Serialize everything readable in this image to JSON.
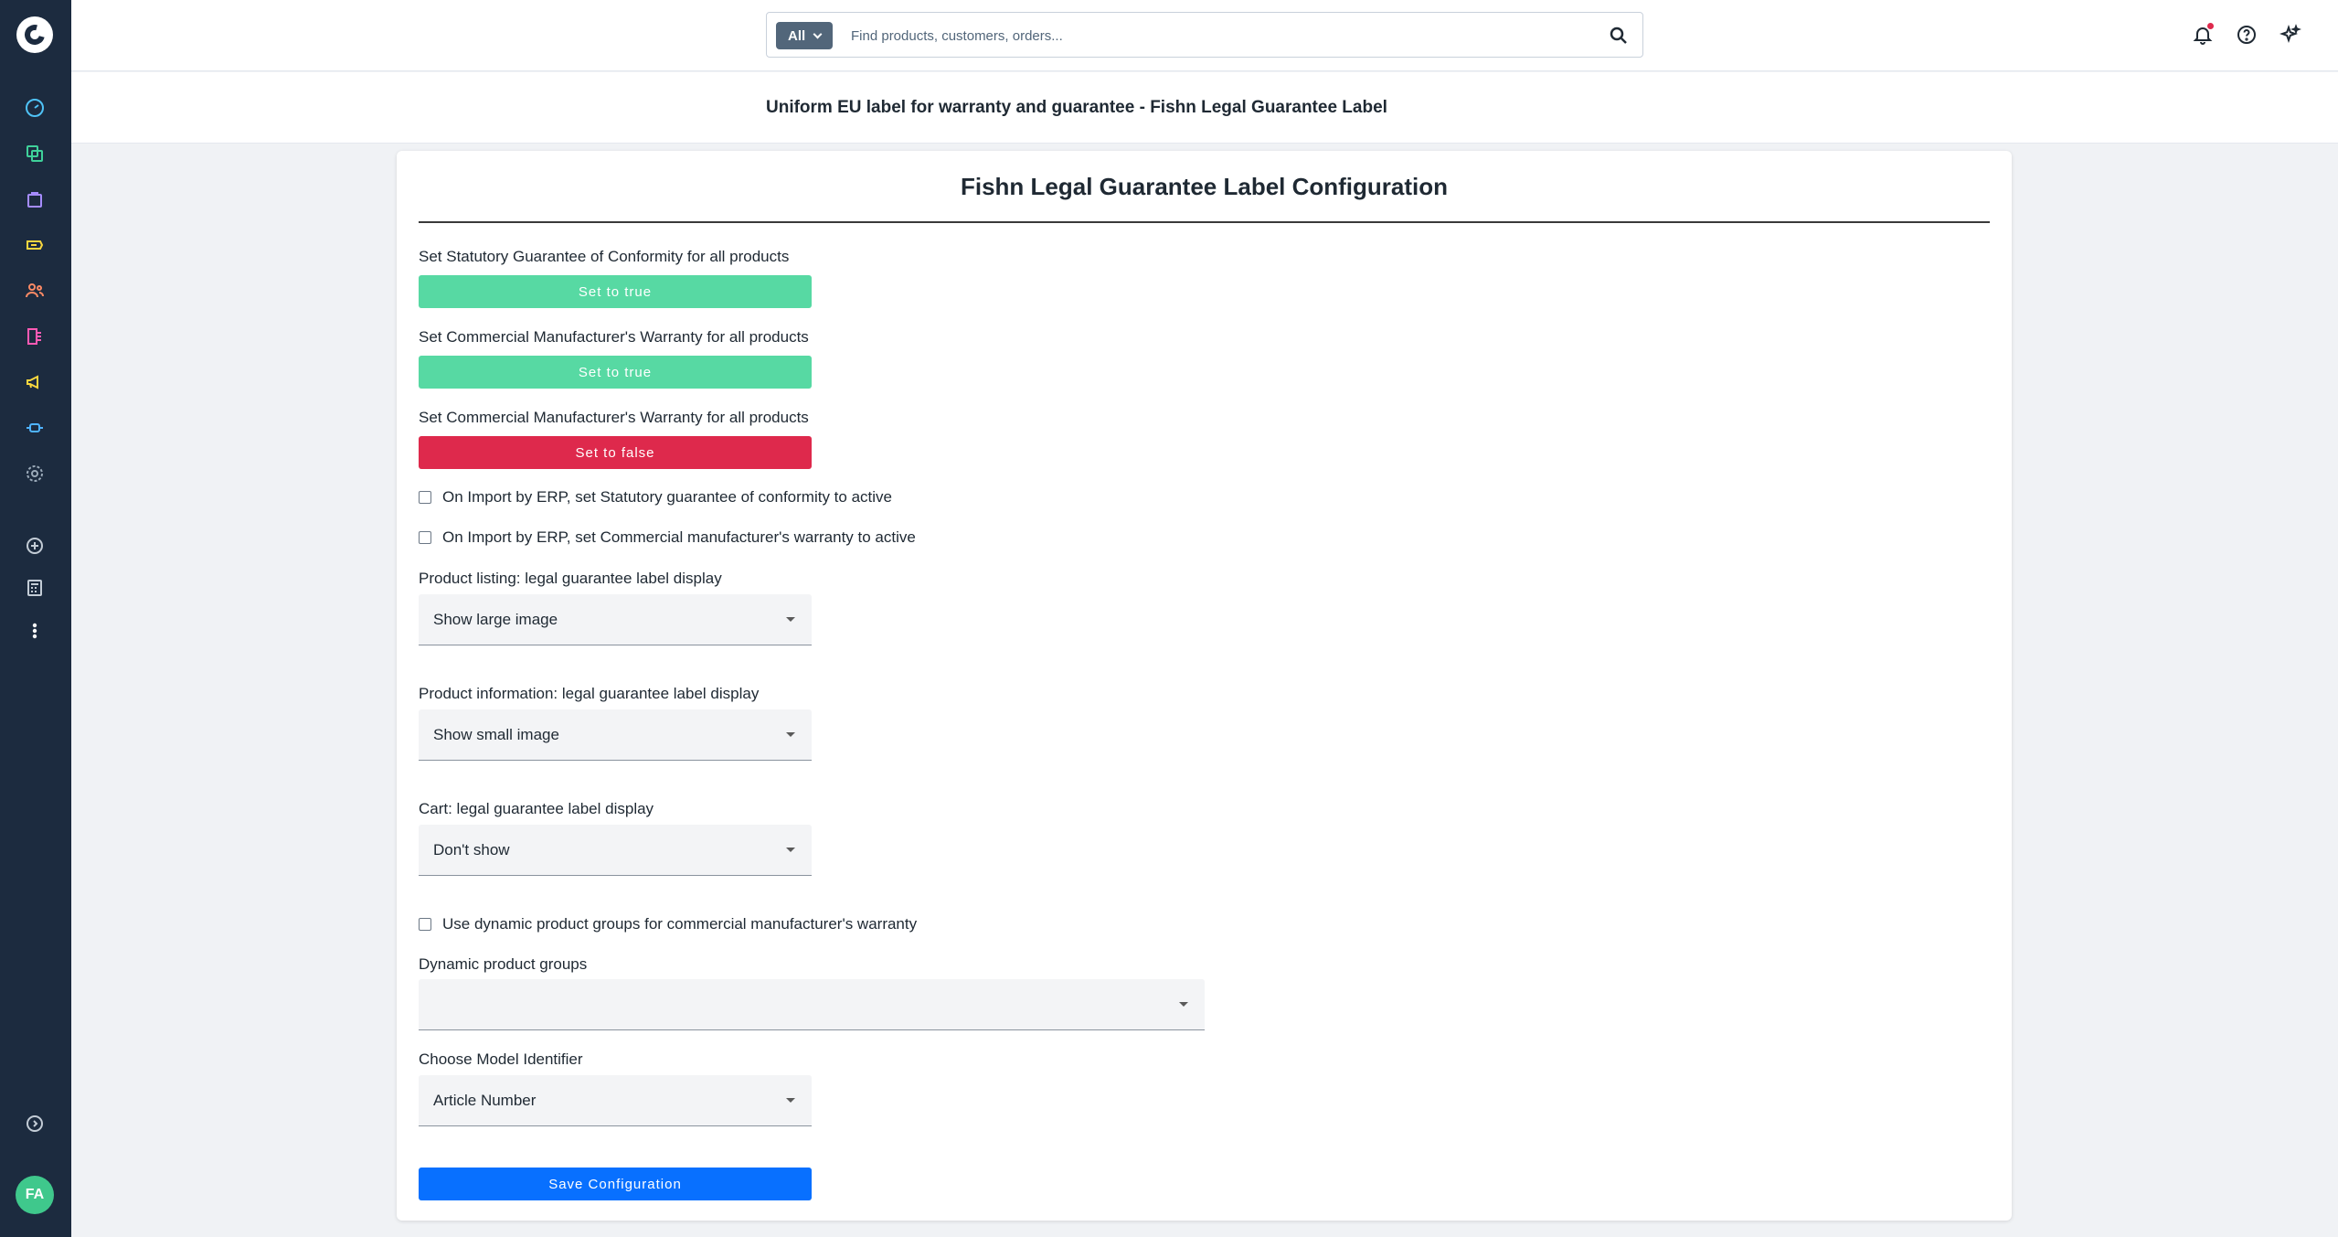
{
  "app": {
    "page_title": "Uniform EU label for warranty and guarantee - Fishn Legal Guarantee Label",
    "user_initials": "FA"
  },
  "colors": {
    "sidebar_bg": "#1c2b3f",
    "true_button": "#57d9a3",
    "false_button": "#de294c",
    "primary_button": "#0870ff",
    "avatar": "#3fc88c"
  },
  "sidebar": {
    "items": [
      {
        "icon": "gauge-icon",
        "color": "#4fc3f7"
      },
      {
        "icon": "catalog-icon",
        "color": "#3fd19a"
      },
      {
        "icon": "orders-bag-icon",
        "color": "#a58cff"
      },
      {
        "icon": "customers-ticket-icon",
        "color": "#f7d63f"
      },
      {
        "icon": "users-icon",
        "color": "#ff8a65"
      },
      {
        "icon": "content-icon",
        "color": "#ff5ab4"
      },
      {
        "icon": "marketing-megaphone-icon",
        "color": "#f7d63f"
      },
      {
        "icon": "extensions-plug-icon",
        "color": "#4fb3ff"
      },
      {
        "icon": "settings-gear-icon",
        "color": "#9aa9b8"
      },
      {
        "icon": "add-circle-icon",
        "color": "#c3ccd6"
      },
      {
        "icon": "calculator-icon",
        "color": "#c3ccd6"
      },
      {
        "icon": "more-vertical-icon",
        "color": "#ffffff"
      },
      {
        "icon": "expand-chevron-icon",
        "color": "#c3ccd6"
      }
    ]
  },
  "search": {
    "scope_label": "All",
    "placeholder": "Find products, customers, orders..."
  },
  "config": {
    "title": "Fishn Legal Guarantee Label Configuration",
    "statutory_label": "Set Statutory Guarantee of Conformity for all products",
    "statutory_button": "Set to true",
    "commercial_true_label": "Set Commercial Manufacturer's Warranty for all products",
    "commercial_true_button": "Set to true",
    "commercial_false_label": "Set Commercial Manufacturer's Warranty for all products",
    "commercial_false_button": "Set to false",
    "erp_statutory_label": "On Import by ERP, set Statutory guarantee of conformity to active",
    "erp_commercial_label": "On Import by ERP, set Commercial manufacturer's warranty to active",
    "listing_label": "Product listing: legal guarantee label display",
    "listing_value": "Show large image",
    "info_label": "Product information: legal guarantee label display",
    "info_value": "Show small image",
    "cart_label": "Cart: legal guarantee label display",
    "cart_value": "Don't show",
    "dynamic_check_label": "Use dynamic product groups for commercial manufacturer's warranty",
    "dynamic_groups_label": "Dynamic product groups",
    "dynamic_groups_value": "",
    "model_label": "Choose Model Identifier",
    "model_value": "Article Number",
    "save_button": "Save Configuration"
  }
}
